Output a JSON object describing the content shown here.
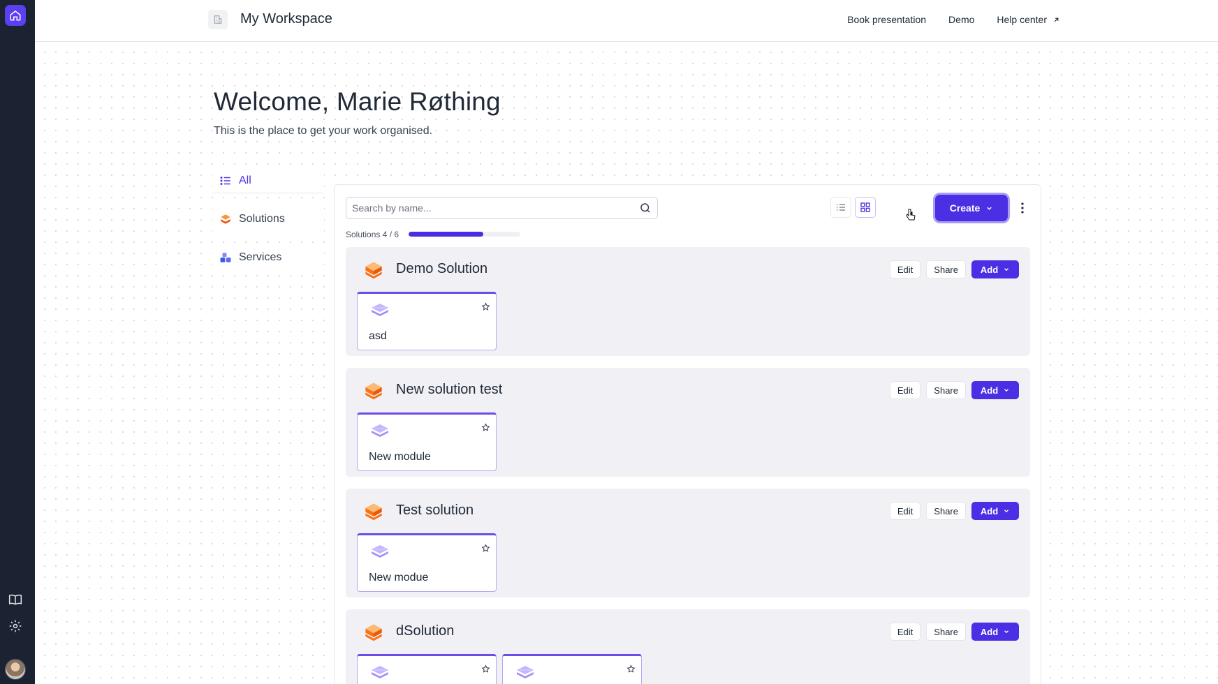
{
  "rail": {
    "icons": [
      "home-icon",
      "book-icon",
      "gear-icon",
      "avatar"
    ]
  },
  "header": {
    "title": "My Workspace",
    "links": {
      "book": "Book presentation",
      "demo": "Demo",
      "help": "Help center"
    }
  },
  "welcome": {
    "heading": "Welcome, Marie Røthing",
    "subtitle": "This is the place to get your work organised."
  },
  "filters": [
    {
      "label": "All",
      "icon": "list-icon",
      "active": true
    },
    {
      "label": "Solutions",
      "icon": "solution-icon",
      "active": false
    },
    {
      "label": "Services",
      "icon": "services-icon",
      "active": false
    }
  ],
  "toolbar": {
    "search_placeholder": "Search by name...",
    "progress_label": "Solutions 4 / 6",
    "progress_fraction": 0.667,
    "create_label": "Create"
  },
  "solutions": [
    {
      "name": "Demo Solution",
      "edit": "Edit",
      "share": "Share",
      "add": "Add",
      "modules": [
        "asd"
      ]
    },
    {
      "name": "New solution test",
      "edit": "Edit",
      "share": "Share",
      "add": "Add",
      "modules": [
        "New module"
      ]
    },
    {
      "name": "Test solution",
      "edit": "Edit",
      "share": "Share",
      "add": "Add",
      "modules": [
        "New modue"
      ]
    },
    {
      "name": "dSolution",
      "edit": "Edit",
      "share": "Share",
      "add": "Add",
      "modules": [
        "",
        ""
      ]
    }
  ],
  "colors": {
    "accent": "#4b2fe4",
    "rail": "#1b2333",
    "solution_orange": "#f97316",
    "module_purple": "#a78bfa"
  }
}
